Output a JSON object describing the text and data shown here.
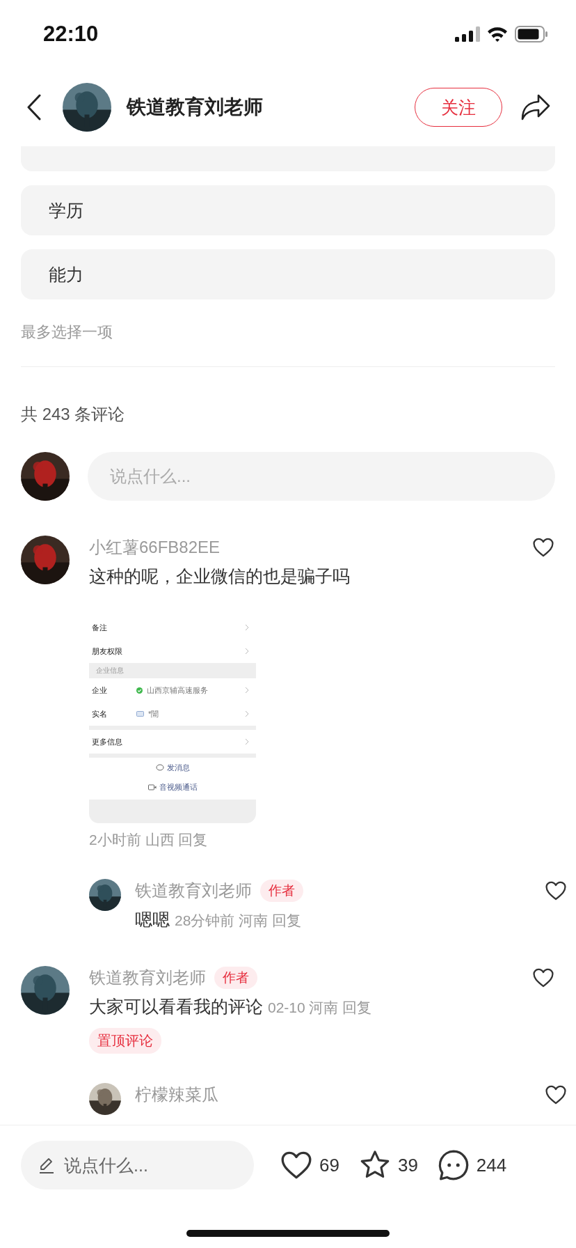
{
  "status_bar": {
    "time": "22:10"
  },
  "header": {
    "author": "铁道教育刘老师",
    "follow_label": "关注"
  },
  "poll": {
    "partial_option_above": true,
    "options": [
      {
        "label": "学历"
      },
      {
        "label": "能力"
      }
    ],
    "hint": "最多选择一项"
  },
  "comments_count": "共 243 条评论",
  "comment_input": {
    "placeholder": "说点什么..."
  },
  "comments": [
    {
      "name": "小红薯66FB82EE",
      "text": "这种的呢，企业微信的也是骗子吗",
      "meta": "2小时前 山西 回复",
      "image": {
        "rows": [
          {
            "label": "备注"
          },
          {
            "label": "朋友权限"
          }
        ],
        "section": "企业信息",
        "info_rows": [
          {
            "label": "企业",
            "value": "山西京辅高速服务",
            "verified": true
          },
          {
            "label": "实名",
            "value": "*闓",
            "verified": false
          }
        ],
        "more": "更多信息",
        "actions": [
          {
            "kind": "message",
            "label": "发消息"
          },
          {
            "kind": "video",
            "label": "音视频通话"
          }
        ]
      },
      "replies": [
        {
          "name": "铁道教育刘老师",
          "badge": "作者",
          "text": "嗯嗯",
          "meta": "28分钟前 河南 回复"
        }
      ]
    },
    {
      "name": "铁道教育刘老师",
      "badge": "作者",
      "text": "大家可以看看我的评论",
      "meta": "02-10 河南 回复",
      "pinned_label": "置顶评论",
      "replies": [
        {
          "name": "柠檬辣菜瓜"
        }
      ]
    }
  ],
  "bottom_bar": {
    "placeholder": "说点什么...",
    "likes": "69",
    "stars": "39",
    "comments": "244"
  }
}
